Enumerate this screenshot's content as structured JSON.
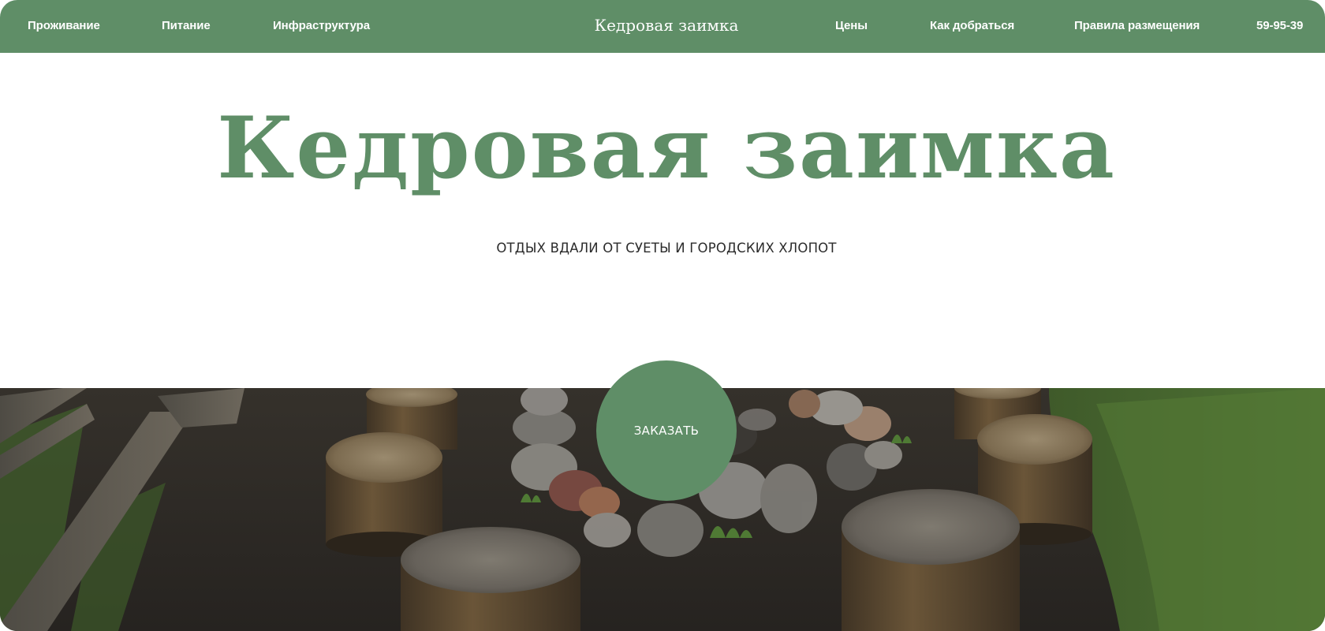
{
  "nav": {
    "left_items": [
      "Проживание",
      "Питание",
      "Инфраструктура"
    ],
    "brand": "Кедровая заимка",
    "right_items": [
      "Цены",
      "Как добраться",
      "Правила размещения"
    ],
    "phone": "59-95-39"
  },
  "hero": {
    "title": "Кедровая заимка",
    "subtitle": "ОТДЫХ ВДАЛИ ОТ СУЕТЫ И ГОРОДСКИХ ХЛОПОТ"
  },
  "order_button": {
    "label": "ЗАКАЗАТЬ"
  },
  "colors": {
    "accent": "#5f8e67",
    "text_dark": "#2b2b2b",
    "background": "#ffffff"
  }
}
